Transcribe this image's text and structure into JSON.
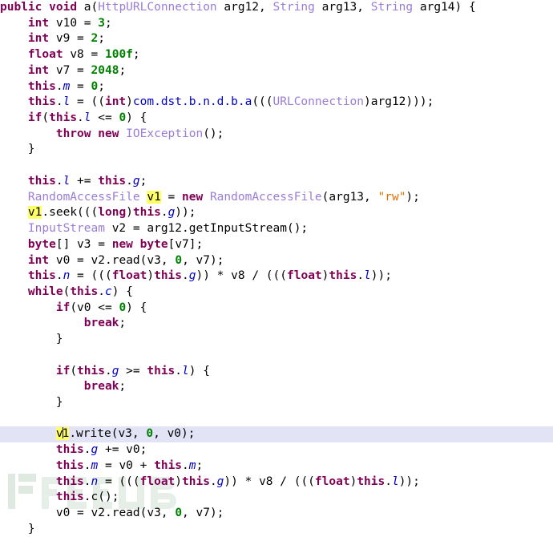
{
  "editor": {
    "language": "java",
    "background": "#ffffff",
    "current_line_background": "#E3E3F6",
    "occurrence_highlight_color": "#FFFF66",
    "colors": {
      "keyword": "#7F0055",
      "type": "#9A7DD6",
      "number": "#008000",
      "string": "#E07000",
      "field": "#0000C0",
      "package": "#0000CC",
      "plain": "#000000"
    },
    "caret_line_index": 24,
    "highlighted_token": "v1"
  },
  "watermark": {
    "text": "FREEBUF",
    "color": "#DDE8DD"
  },
  "code": {
    "lines": [
      "public void a(HttpURLConnection arg12, String arg13, String arg14) {",
      "    int v10 = 3;",
      "    int v9 = 2;",
      "    float v8 = 100f;",
      "    int v7 = 2048;",
      "    this.m = 0;",
      "    this.l = ((int)com.dst.b.n.d.b.a(((URLConnection)arg12)));",
      "    if(this.l <= 0) {",
      "        throw new IOException();",
      "    }",
      "",
      "    this.l += this.g;",
      "    RandomAccessFile v1 = new RandomAccessFile(arg13, \"rw\");",
      "    v1.seek(((long)this.g));",
      "    InputStream v2 = arg12.getInputStream();",
      "    byte[] v3 = new byte[v7];",
      "    int v0 = v2.read(v3, 0, v7);",
      "    this.n = (((float)this.g)) * v8 / (((float)this.l));",
      "    while(this.c) {",
      "        if(v0 <= 0) {",
      "            break;",
      "        }",
      "",
      "        if(this.g >= this.l) {",
      "            break;",
      "        }",
      "",
      "        v1.write(v3, 0, v0);",
      "        this.g += v0;",
      "        this.m = v0 + this.m;",
      "        this.n = (((float)this.g)) * v8 / (((float)this.l));",
      "        this.c();",
      "        v0 = v2.read(v3, 0, v7);",
      "    }"
    ]
  }
}
